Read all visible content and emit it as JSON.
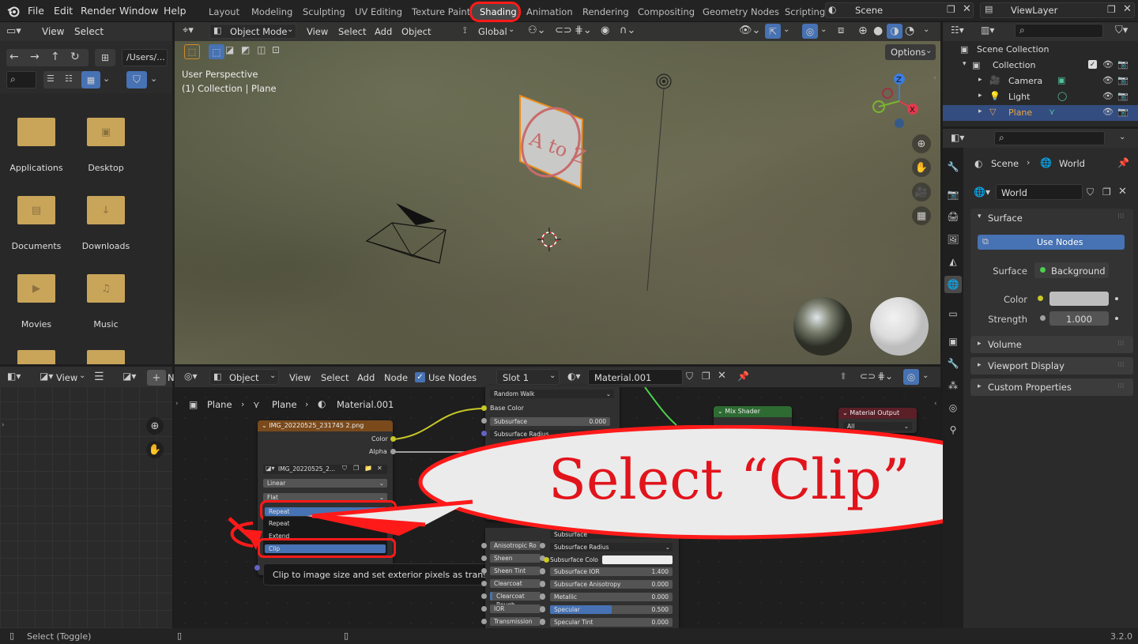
{
  "menu": {
    "items": [
      "File",
      "Edit",
      "Render",
      "Window",
      "Help"
    ]
  },
  "workspaces": {
    "tabs": [
      "Layout",
      "Modeling",
      "Sculpting",
      "UV Editing",
      "Texture Paint",
      "Shading",
      "Animation",
      "Rendering",
      "Compositing",
      "Geometry Nodes",
      "Scripting"
    ],
    "active": "Shading"
  },
  "scene": {
    "label": "Scene",
    "view_layer": "ViewLayer"
  },
  "file_browser": {
    "menu": [
      "View",
      "Select"
    ],
    "path": "/Users/...",
    "folders": [
      "Applications",
      "Desktop",
      "Documents",
      "Downloads",
      "Movies",
      "Music"
    ]
  },
  "viewport": {
    "mode": "Object Mode",
    "menu": [
      "View",
      "Select",
      "Add",
      "Object"
    ],
    "orientation": "Global",
    "options": "Options",
    "perspective": "User Perspective",
    "collection_info": "(1) Collection | Plane",
    "axes": {
      "x": "X",
      "y": "Y",
      "z": "Z"
    },
    "plane_text": "A to Z"
  },
  "image_editor": {
    "view": "View",
    "new_label": "N"
  },
  "node_editor": {
    "type": "Object",
    "menu": [
      "View",
      "Select",
      "Add",
      "Node"
    ],
    "use_nodes": "Use Nodes",
    "slot": "Slot 1",
    "material": "Material.001",
    "breadcrumb": [
      "Plane",
      "Plane",
      "Material.001"
    ]
  },
  "image_node": {
    "title": "IMG_20220525_231745 2.png",
    "outputs": [
      "Color",
      "Alpha"
    ],
    "image_name": "IMG_20220525_2...",
    "interpolation": "Linear",
    "projection": "Flat",
    "extension": "Repeat",
    "dropdown_options": [
      "Repeat",
      "Extend",
      "Clip"
    ],
    "tooltip": "Clip to image size and set exterior pixels as transparent."
  },
  "bsdf_node": {
    "subsurface_method": "Random Walk",
    "rows": [
      {
        "label": "Base Color"
      },
      {
        "label": "Subsurface",
        "value": "0.000"
      },
      {
        "label": "Subsurface Radius"
      }
    ],
    "lower_left": [
      "Anisotropic Ro",
      "Sheen",
      "Sheen Tint",
      "Clearcoat",
      "Clearcoat Rough",
      "IOR",
      "Transmission"
    ],
    "lower_right": [
      {
        "label": "Subsurface",
        "value": ""
      },
      {
        "label": "Subsurface Radius",
        "value": ""
      },
      {
        "label": "Subsurface Colo",
        "value": ""
      },
      {
        "label": "Subsurface IOR",
        "value": "1.400"
      },
      {
        "label": "Subsurface Anisotropy",
        "value": "0.000"
      },
      {
        "label": "Metallic",
        "value": "0.000"
      },
      {
        "label": "Specular",
        "value": "0.500"
      },
      {
        "label": "Specular Tint",
        "value": "0.000"
      }
    ],
    "specular_fraction": 0.5
  },
  "mix_node": {
    "title": "Mix Shader"
  },
  "output_node": {
    "title": "Material Output",
    "target": "All"
  },
  "callout": {
    "text": "Select “Clip”"
  },
  "outliner": {
    "root": "Scene Collection",
    "collection": "Collection",
    "items": [
      "Camera",
      "Light",
      "Plane"
    ],
    "active": "Plane"
  },
  "properties": {
    "breadcrumb": [
      "Scene",
      "World"
    ],
    "world_name": "World",
    "surface_panel": "Surface",
    "use_nodes": "Use Nodes",
    "surface_label": "Surface",
    "surface_value": "Background",
    "color_label": "Color",
    "strength_label": "Strength",
    "strength_value": "1.000",
    "panels": [
      "Volume",
      "Viewport Display",
      "Custom Properties"
    ]
  },
  "status": {
    "left": "Select (Toggle)",
    "version": "3.2.0"
  },
  "colors": {
    "accent": "#4772b3",
    "highlight_red": "#ff1a1a",
    "image_node_header": "#7a4a1c",
    "mix_header": "#2e6b32",
    "output_header": "#5a1f27"
  }
}
